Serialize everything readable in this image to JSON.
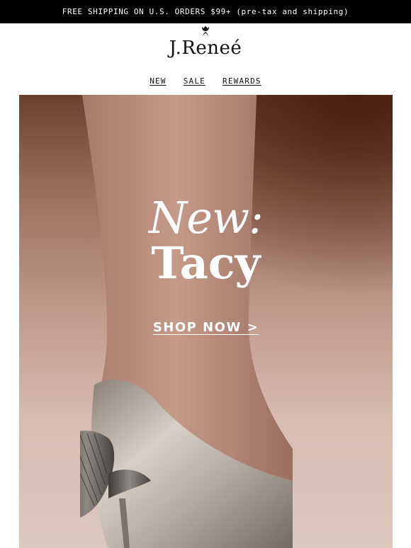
{
  "banner": {
    "text": "FREE SHIPPING ON U.S. ORDERS $99+ (pre-tax and shipping)"
  },
  "brand": {
    "logo_text": "J.Reneé",
    "logo_icon": "flower-icon"
  },
  "nav": {
    "items": [
      {
        "label": "NEW"
      },
      {
        "label": "SALE"
      },
      {
        "label": "REWARDS"
      }
    ]
  },
  "hero": {
    "headline_line1": "New:",
    "headline_line2": "Tacy",
    "cta_label": "SHOP NOW >",
    "image_subject": "metallic-pump-shoe-image"
  },
  "colors": {
    "banner_bg": "#000000",
    "banner_text": "#ffffff",
    "hero_text": "#ffffff"
  }
}
